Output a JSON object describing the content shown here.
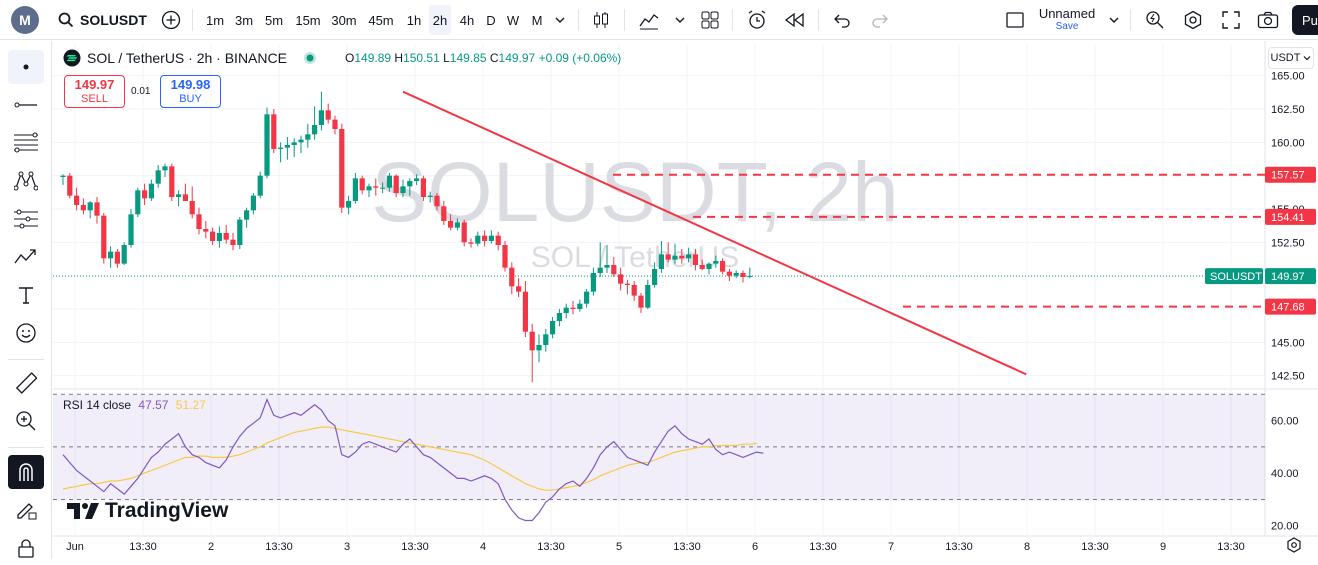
{
  "topbar": {
    "symbol": "SOLUSDT",
    "timeframes": [
      "1m",
      "3m",
      "5m",
      "15m",
      "30m",
      "45m",
      "1h",
      "2h",
      "4h",
      "D",
      "W",
      "M"
    ],
    "active_timeframe": "2h",
    "layout_name": "Unnamed",
    "layout_save": "Save",
    "publish_label": "Pu"
  },
  "legend": {
    "title": "SOL / TetherUS · 2h · BINANCE",
    "o_label": "O",
    "o": "149.89",
    "h_label": "H",
    "h": "150.51",
    "l_label": "L",
    "l": "149.85",
    "c_label": "C",
    "c": "149.97",
    "change": "+0.09 (+0.06%)",
    "sell_price": "149.97",
    "sell_label": "SELL",
    "spread": "0.01",
    "buy_price": "149.98",
    "buy_label": "BUY"
  },
  "watermark": {
    "big": "SOLUSDT, 2h",
    "small": "SOL / TetherUS"
  },
  "currency": "USDT",
  "rsi_legend": {
    "name": "RSI 14 close",
    "v1": "47.57",
    "v2": "51.27"
  },
  "brand": "TradingView",
  "colors": {
    "up": "#089981",
    "down": "#f23645",
    "rsi": "#7e57c2",
    "rsi_ma": "#f7c948",
    "accent": "#2962ff"
  },
  "chart_data": {
    "type": "candlestick",
    "title": "SOL / TetherUS · 2h · BINANCE",
    "y_ticks": [
      "165.00",
      "162.50",
      "160.00",
      "157.50",
      "155.00",
      "152.50",
      "150.00",
      "147.50",
      "145.00",
      "142.50"
    ],
    "y_range": [
      141.5,
      165.5
    ],
    "x_labels": [
      "Jun",
      "13:30",
      "2",
      "13:30",
      "3",
      "13:30",
      "4",
      "13:30",
      "5",
      "13:30",
      "6",
      "13:30",
      "7",
      "13:30",
      "8",
      "13:30",
      "9",
      "13:30"
    ],
    "price_tags": [
      {
        "label": "157.57",
        "value": 157.57,
        "color": "#f23645"
      },
      {
        "label": "154.41",
        "value": 154.41,
        "color": "#f23645"
      },
      {
        "label": "147.68",
        "value": 147.68,
        "color": "#f23645"
      },
      {
        "label": "149.97",
        "value": 149.97,
        "color": "#089981"
      }
    ],
    "symbol_tag": "SOLUSDT",
    "horizontal_levels": [
      157.57,
      154.41,
      147.68
    ],
    "trendline": {
      "from": [
        0,
        163.8
      ],
      "to": [
        74,
        142.6
      ]
    },
    "last_price": 149.97,
    "candles": [
      [
        157.4,
        157.6,
        156.8,
        157.5
      ],
      [
        157.5,
        157.7,
        155.8,
        156.0
      ],
      [
        156.0,
        156.6,
        154.9,
        155.3
      ],
      [
        155.3,
        155.8,
        154.6,
        154.9
      ],
      [
        154.9,
        155.6,
        154.3,
        155.5
      ],
      [
        155.5,
        155.9,
        153.9,
        154.5
      ],
      [
        154.5,
        154.7,
        150.9,
        151.3
      ],
      [
        151.3,
        152.2,
        150.6,
        151.8
      ],
      [
        151.8,
        152.0,
        150.6,
        150.9
      ],
      [
        150.9,
        152.5,
        150.8,
        152.3
      ],
      [
        152.3,
        155.0,
        152.1,
        154.6
      ],
      [
        154.6,
        156.6,
        154.4,
        156.4
      ],
      [
        156.4,
        156.9,
        155.3,
        155.8
      ],
      [
        155.8,
        157.2,
        155.6,
        156.9
      ],
      [
        156.9,
        158.3,
        156.6,
        157.9
      ],
      [
        157.9,
        158.4,
        157.4,
        158.2
      ],
      [
        158.2,
        158.4,
        155.6,
        155.9
      ],
      [
        155.9,
        156.4,
        155.2,
        156.1
      ],
      [
        156.1,
        156.9,
        155.6,
        155.6
      ],
      [
        155.6,
        156.7,
        154.3,
        154.6
      ],
      [
        154.6,
        155.1,
        153.1,
        153.5
      ],
      [
        153.5,
        154.1,
        152.8,
        153.3
      ],
      [
        153.3,
        153.6,
        152.3,
        152.6
      ],
      [
        152.6,
        153.7,
        152.1,
        153.2
      ],
      [
        153.2,
        153.8,
        152.4,
        152.7
      ],
      [
        152.7,
        153.2,
        151.9,
        152.3
      ],
      [
        152.3,
        154.4,
        152.0,
        154.2
      ],
      [
        154.2,
        155.1,
        153.6,
        154.9
      ],
      [
        154.9,
        156.2,
        154.6,
        156.0
      ],
      [
        156.0,
        157.8,
        155.8,
        157.5
      ],
      [
        157.5,
        162.6,
        157.3,
        162.1
      ],
      [
        162.1,
        162.5,
        159.2,
        159.5
      ],
      [
        159.5,
        160.0,
        158.5,
        159.6
      ],
      [
        159.6,
        160.4,
        158.7,
        159.8
      ],
      [
        159.8,
        160.3,
        158.9,
        160.0
      ],
      [
        160.0,
        160.5,
        159.2,
        160.2
      ],
      [
        160.2,
        161.4,
        159.6,
        160.6
      ],
      [
        160.6,
        162.7,
        160.2,
        161.3
      ],
      [
        161.3,
        163.8,
        160.9,
        162.4
      ],
      [
        162.4,
        162.9,
        161.4,
        161.7
      ],
      [
        161.7,
        162.0,
        160.6,
        161.0
      ],
      [
        161.0,
        161.4,
        154.7,
        155.1
      ],
      [
        155.1,
        156.0,
        154.6,
        155.6
      ],
      [
        155.6,
        157.7,
        155.4,
        157.3
      ],
      [
        157.3,
        157.5,
        156.1,
        156.4
      ],
      [
        156.4,
        156.9,
        155.9,
        156.7
      ],
      [
        156.7,
        157.3,
        156.0,
        156.6
      ],
      [
        156.6,
        157.0,
        156.2,
        156.6
      ],
      [
        156.6,
        157.7,
        156.3,
        157.5
      ],
      [
        157.5,
        157.6,
        155.9,
        156.2
      ],
      [
        156.2,
        157.2,
        155.9,
        156.7
      ],
      [
        156.7,
        157.3,
        156.0,
        157.1
      ],
      [
        157.1,
        157.6,
        156.8,
        157.3
      ],
      [
        157.3,
        157.5,
        155.6,
        155.9
      ],
      [
        155.9,
        156.3,
        155.5,
        156.0
      ],
      [
        156.0,
        156.2,
        154.9,
        155.2
      ],
      [
        155.2,
        155.6,
        153.8,
        154.1
      ],
      [
        154.1,
        154.6,
        153.4,
        153.6
      ],
      [
        153.6,
        154.3,
        153.4,
        154.0
      ],
      [
        154.0,
        154.2,
        152.2,
        152.5
      ],
      [
        152.5,
        152.8,
        152.1,
        152.4
      ],
      [
        152.4,
        153.3,
        152.2,
        153.0
      ],
      [
        153.0,
        153.4,
        152.2,
        152.6
      ],
      [
        152.6,
        153.4,
        152.4,
        153.0
      ],
      [
        153.0,
        153.3,
        151.9,
        152.3
      ],
      [
        152.3,
        152.6,
        150.3,
        150.6
      ],
      [
        150.6,
        151.0,
        148.6,
        149.2
      ],
      [
        149.2,
        149.8,
        148.4,
        148.8
      ],
      [
        148.8,
        149.6,
        145.4,
        145.8
      ],
      [
        145.8,
        146.4,
        142.0,
        144.4
      ],
      [
        144.4,
        145.6,
        143.5,
        144.8
      ],
      [
        144.8,
        146.0,
        144.3,
        145.6
      ],
      [
        145.6,
        146.9,
        145.3,
        146.6
      ],
      [
        146.6,
        147.5,
        146.2,
        147.2
      ],
      [
        147.2,
        147.9,
        146.8,
        147.6
      ],
      [
        147.6,
        148.1,
        147.1,
        147.5
      ],
      [
        147.5,
        148.2,
        147.3,
        147.9
      ],
      [
        147.9,
        149.0,
        147.6,
        148.8
      ],
      [
        148.8,
        150.6,
        148.5,
        150.2
      ],
      [
        150.2,
        152.5,
        149.9,
        150.6
      ],
      [
        150.6,
        152.3,
        150.2,
        150.8
      ],
      [
        150.8,
        151.4,
        149.9,
        150.1
      ],
      [
        150.1,
        150.6,
        148.9,
        149.4
      ],
      [
        149.4,
        149.7,
        148.6,
        149.3
      ],
      [
        149.3,
        149.6,
        148.1,
        148.5
      ],
      [
        148.5,
        148.7,
        147.2,
        147.6
      ],
      [
        147.6,
        149.7,
        147.5,
        149.3
      ],
      [
        149.3,
        151.0,
        149.1,
        150.5
      ],
      [
        150.5,
        152.6,
        150.2,
        151.6
      ],
      [
        151.6,
        152.5,
        151.0,
        151.2
      ],
      [
        151.2,
        152.4,
        150.9,
        151.5
      ],
      [
        151.5,
        152.0,
        150.9,
        151.3
      ],
      [
        151.3,
        152.1,
        151.0,
        151.6
      ],
      [
        151.6,
        152.0,
        150.4,
        150.8
      ],
      [
        150.8,
        151.2,
        150.4,
        150.5
      ],
      [
        150.5,
        151.0,
        150.1,
        150.9
      ],
      [
        150.9,
        151.5,
        150.6,
        151.1
      ],
      [
        151.1,
        151.3,
        150.1,
        150.3
      ],
      [
        150.3,
        150.5,
        149.6,
        150.0
      ],
      [
        150.0,
        150.4,
        149.8,
        150.2
      ],
      [
        150.2,
        150.4,
        149.5,
        149.9
      ],
      [
        149.9,
        150.6,
        149.8,
        149.97
      ]
    ],
    "rsi": {
      "y_ticks": [
        "60.00",
        "40.00",
        "20.00"
      ],
      "y_range": [
        18,
        72
      ],
      "levels": [
        70,
        50,
        30
      ],
      "values": [
        47,
        44,
        41,
        39,
        37,
        35,
        33,
        36,
        34,
        32,
        35,
        38,
        42,
        46,
        48,
        51,
        53,
        55,
        50,
        47,
        46,
        44,
        43,
        42,
        45,
        50,
        54,
        57,
        59,
        61,
        68,
        62,
        61,
        62,
        63,
        62,
        64,
        66,
        64,
        60,
        58,
        47,
        46,
        48,
        51,
        52,
        51,
        50,
        49,
        48,
        51,
        53,
        50,
        47,
        46,
        44,
        42,
        40,
        38,
        38,
        37,
        38,
        39,
        38,
        36,
        30,
        26,
        23,
        22,
        22,
        25,
        29,
        31,
        34,
        36,
        37,
        35,
        38,
        42,
        47,
        50,
        52,
        49,
        46,
        45,
        44,
        43,
        48,
        52,
        56,
        58,
        55,
        53,
        52,
        51,
        53,
        49,
        47,
        48,
        47,
        46,
        47,
        48,
        47.57
      ],
      "ma_values": [
        34,
        34.5,
        35,
        35.5,
        36,
        36,
        36.5,
        37,
        37,
        37.5,
        38,
        39,
        40,
        41,
        42,
        43,
        44,
        45,
        46,
        46,
        46.5,
        46.5,
        46,
        46,
        46,
        46.5,
        47,
        48,
        49,
        50,
        51.5,
        52.5,
        53.5,
        54.5,
        55.5,
        56,
        56.5,
        57,
        57.5,
        57.5,
        57,
        56.5,
        56,
        55.5,
        55,
        54.5,
        54,
        53.5,
        53,
        52.5,
        52,
        51.5,
        51,
        50.5,
        50,
        49.5,
        49,
        48.5,
        48,
        47.5,
        47,
        46,
        45,
        43.5,
        42,
        40.5,
        39,
        37.5,
        36,
        35,
        34,
        33.5,
        33.5,
        34,
        34.5,
        35,
        35.5,
        36.5,
        37.5,
        39,
        40,
        41,
        42,
        43,
        43.5,
        44,
        44,
        45,
        46,
        47,
        48,
        48.5,
        49,
        49.5,
        50,
        50,
        50.5,
        50.5,
        50.5,
        50.5,
        51,
        51,
        51.27
      ]
    }
  }
}
